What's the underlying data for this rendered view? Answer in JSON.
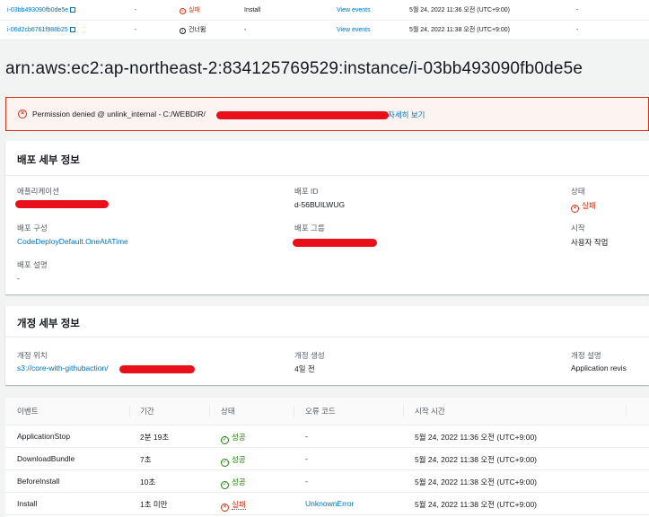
{
  "top_rows": [
    {
      "instance_id": "i-03bb493090fb0de5e",
      "dash1": "-",
      "status": "실패",
      "status_kind": "fail",
      "last_event": "Install",
      "link": "View events",
      "time": "5월 24, 2022 11:36 오전 (UTC+9:00)",
      "dash2": "-"
    },
    {
      "instance_id": "i-06d2cb6761f988b25",
      "dash1": "-",
      "status": "건너뜀",
      "status_kind": "skipped",
      "last_event": "-",
      "link": "View events",
      "time": "5월 24, 2022 11:38 오전 (UTC+9:00)",
      "dash2": "-"
    }
  ],
  "page_title": "arn:aws:ec2:ap-northeast-2:834125769529:instance/i-03bb493090fb0de5e",
  "alert": {
    "message": "Permission denied @ unlink_internal - C:/WEBDIR/",
    "link": "자세히 보기"
  },
  "deployment": {
    "title": "배포 세부 정보",
    "app_label": "애플리케이션",
    "id_label": "배포 ID",
    "id_value": "d-56BUILWUG",
    "status_label": "상태",
    "status_value": "실패",
    "config_label": "배포 구성",
    "config_value": "CodeDeployDefault.OneAtATime",
    "group_label": "배포 그룹",
    "start_label": "시작",
    "start_value": "사용자 작업",
    "desc_label": "배포 설명",
    "desc_value": "-"
  },
  "revision": {
    "title": "개정 세부 정보",
    "location_label": "개정 위치",
    "location_value": "s3://core-with-githubaction/",
    "created_label": "개정 생성",
    "created_value": "4일 전",
    "desc_label": "개정 설명",
    "desc_value": "Application revis"
  },
  "events": {
    "headers": [
      "이벤트",
      "기간",
      "상태",
      "오류 코드",
      "시작 시간"
    ],
    "rows": [
      {
        "event": "ApplicationStop",
        "duration": "2분 19초",
        "status": "성공",
        "kind": "ok",
        "error": "-",
        "start": "5월 24, 2022 11:36 오전 (UTC+9:00)"
      },
      {
        "event": "DownloadBundle",
        "duration": "7초",
        "status": "성공",
        "kind": "ok",
        "error": "-",
        "start": "5월 24, 2022 11:38 오전 (UTC+9:00)"
      },
      {
        "event": "BeforeInstall",
        "duration": "10초",
        "status": "성공",
        "kind": "ok",
        "error": "-",
        "start": "5월 24, 2022 11:38 오전 (UTC+9:00)"
      },
      {
        "event": "Install",
        "duration": "1초 미만",
        "status": "실패",
        "kind": "fail",
        "error": "UnknownError",
        "start": "5월 24, 2022 11:38 오전 (UTC+9:00)"
      }
    ]
  },
  "colors": {
    "accent": "#0073bb",
    "fail": "#d13212",
    "success": "#1d8102",
    "redaction": "#e8111b"
  }
}
